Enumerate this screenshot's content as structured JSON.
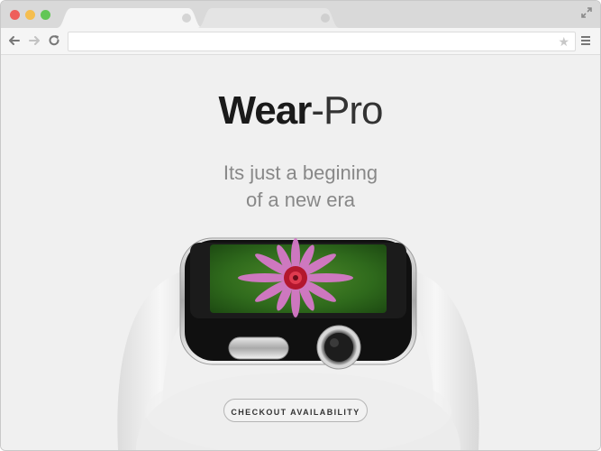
{
  "browser": {
    "colors": {
      "close": "#ee5f5b",
      "minimize": "#f5be4f",
      "zoom": "#62c655"
    }
  },
  "hero": {
    "brand_bold": "Wear",
    "brand_light": "-Pro",
    "tagline_line1": "Its just a begining",
    "tagline_line2": "of a new era",
    "cta_label": "CHECKOUT AVAILABILITY"
  }
}
